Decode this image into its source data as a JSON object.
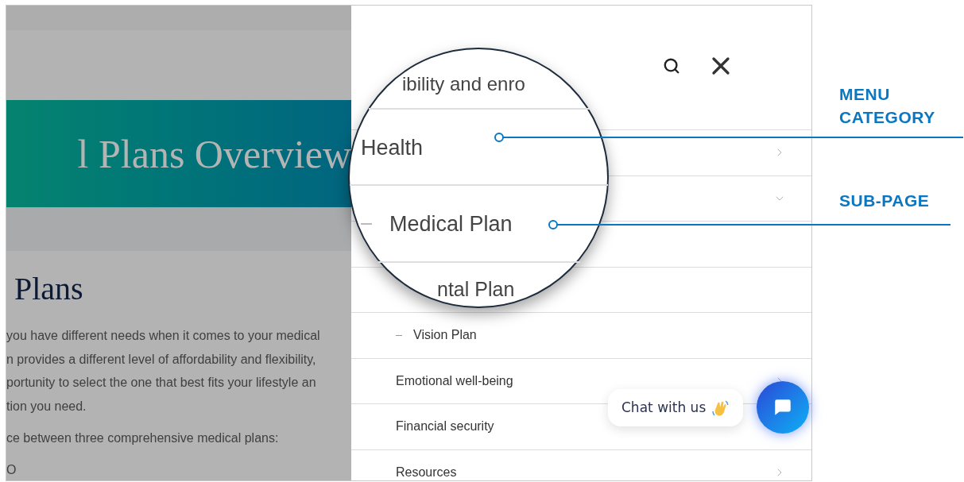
{
  "page": {
    "banner_title": "l Plans Overview",
    "heading": "Plans",
    "paragraph_lines": [
      "you have different needs when it comes to your medical",
      "n provides a different level of affordability and flexibility,",
      "portunity to select the one that best fits your lifestyle an",
      "tion you need."
    ],
    "intro_line": "ce between three comprehensive medical plans:",
    "list_start": "O"
  },
  "menu": {
    "items": [
      {
        "kind": "hidden",
        "expanded": false
      },
      {
        "kind": "hidden",
        "expanded": true
      },
      {
        "kind": "hidden"
      },
      {
        "kind": "hidden"
      },
      {
        "kind": "sub",
        "label": "Vision Plan"
      },
      {
        "kind": "category",
        "label": "Emotional well-being",
        "expanded": false
      },
      {
        "kind": "category",
        "label": "Financial security"
      },
      {
        "kind": "category",
        "label": "Resources",
        "expanded": false
      }
    ]
  },
  "magnifier": {
    "top_text": "ibility and enro",
    "category": "Health",
    "sub_page": "Medical Plan",
    "next_sub_page": "ntal Plan"
  },
  "chat": {
    "label": "Chat with us"
  },
  "callouts": [
    {
      "label": "MENU CATEGORY"
    },
    {
      "label": "SUB-PAGE"
    }
  ]
}
